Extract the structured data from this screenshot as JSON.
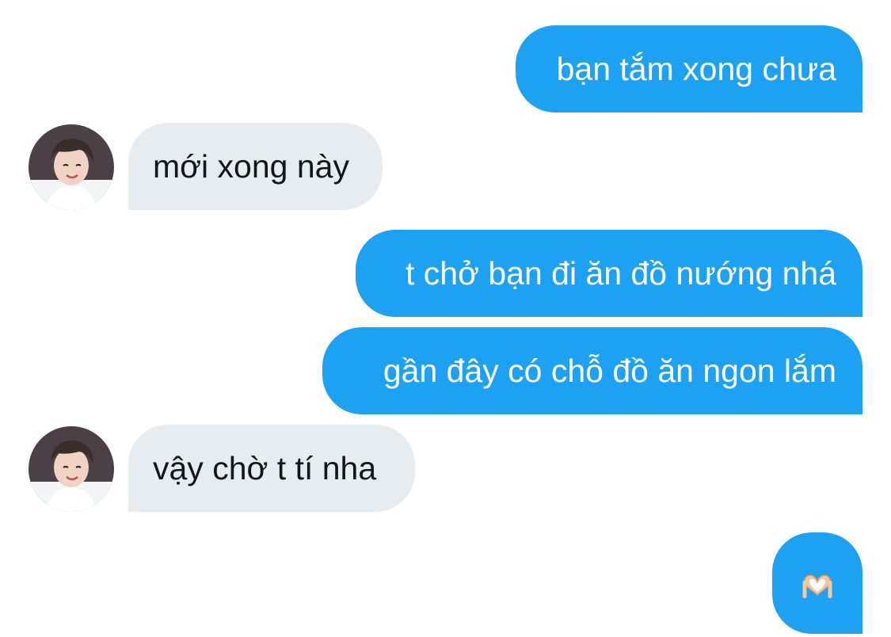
{
  "chat": {
    "messages": [
      {
        "sender": "me",
        "text": "bạn tắm xong chưa"
      },
      {
        "sender": "other",
        "text": "mới xong này"
      },
      {
        "sender": "me",
        "text": "t chở bạn đi ăn đồ nướng nhá"
      },
      {
        "sender": "me",
        "text": "gần đây có chỗ đồ ăn ngon lắm"
      },
      {
        "sender": "other",
        "text": "vậy chờ t tí nha"
      },
      {
        "sender": "me",
        "emoji": "heart-hands-emoji"
      }
    ]
  },
  "colors": {
    "outgoing_bubble": "#1da1f2",
    "incoming_bubble": "#e6ecf0",
    "outgoing_text": "#ffffff",
    "incoming_text": "#14171a"
  },
  "icons": {
    "avatar": "profile-photo",
    "reaction": "heart-hands-emoji"
  }
}
